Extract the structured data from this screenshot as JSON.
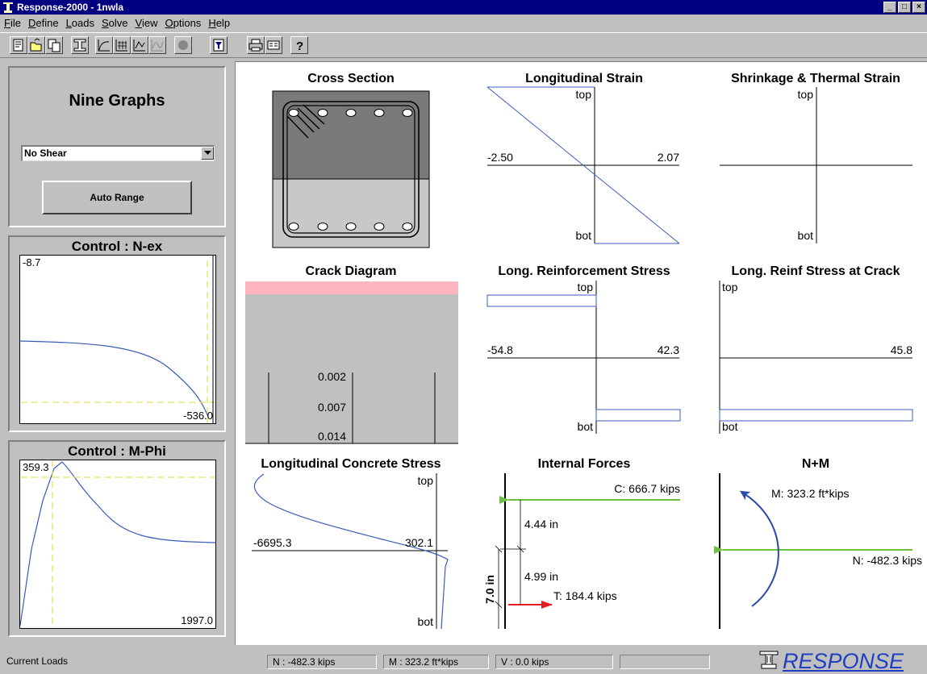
{
  "window": {
    "title": "Response-2000  -  1nwla",
    "controls": [
      "_",
      "□",
      "×"
    ]
  },
  "menu": [
    "File",
    "Define",
    "Loads",
    "Solve",
    "View",
    "Options",
    "Help"
  ],
  "toolbar": {
    "buttons": [
      "new-section-icon",
      "open-file-icon",
      "copy-icon",
      "i-section-icon",
      "curve-icon",
      "grid-icon",
      "check-graph-icon",
      "wave-icon",
      "circle-icon",
      "filter-icon",
      "print-icon",
      "display-icon",
      "help-icon"
    ]
  },
  "left_panel": {
    "title": "Nine Graphs",
    "shear_select": "No Shear",
    "auto_range_label": "Auto Range"
  },
  "control_nex": {
    "title": "Control : N-ex",
    "top_label": "-8.7",
    "bottom_label": "-536.0"
  },
  "control_mphi": {
    "title": "Control : M-Phi",
    "top_label": "359.3",
    "bottom_label": "1997.0"
  },
  "graphs": {
    "cross_section": {
      "title": "Cross Section"
    },
    "longitudinal_strain": {
      "title": "Longitudinal Strain",
      "top": "top",
      "bot": "bot",
      "left_value": "-2.50",
      "right_value": "2.07"
    },
    "shrinkage_thermal": {
      "title": "Shrinkage & Thermal Strain",
      "top": "top",
      "bot": "bot"
    },
    "crack_diagram": {
      "title": "Crack Diagram",
      "widths": [
        "0.002",
        "0.007",
        "0.014"
      ]
    },
    "long_reinf_stress": {
      "title": "Long. Reinforcement Stress",
      "top": "top",
      "bot": "bot",
      "left_value": "-54.8",
      "right_value": "42.3"
    },
    "long_reinf_stress_crack": {
      "title": "Long. Reinf Stress at Crack",
      "top": "top",
      "bot": "bot",
      "right_value": "45.8"
    },
    "long_concrete_stress": {
      "title": "Longitudinal Concrete Stress",
      "top": "top",
      "bot": "bot",
      "left_value": "-6695.3",
      "right_value": "302.1"
    },
    "internal_forces": {
      "title": "Internal Forces",
      "compression": "C: 666.7 kips",
      "tension": "T: 184.4 kips",
      "dim1": "4.44 in",
      "dim2": "4.99 in",
      "lever_arm": "7.0 in"
    },
    "n_plus_m": {
      "title": "N+M",
      "moment": "M: 323.2 ft*kips",
      "axial": "N: -482.3 kips"
    }
  },
  "statusbar": {
    "label": "Current Loads",
    "n": "N : -482.3 kips",
    "m": "M : 323.2 ft*kips",
    "v": "V :  0.0 kips",
    "empty": ""
  },
  "brand": {
    "text": "RESPONSE"
  },
  "colors": {
    "title_bar": "#000080",
    "chart_line": "#3a5cb8",
    "guide_line": "#e8e060",
    "compression_arrow": "#6ec040",
    "tension_arrow": "#e02020",
    "moment_arrow": "#2a4aa8",
    "crack_pink": "#ffb6c1",
    "section_dark": "#7a7a7a",
    "section_light": "#c8c8c8",
    "brand": "#1f3fbf"
  }
}
